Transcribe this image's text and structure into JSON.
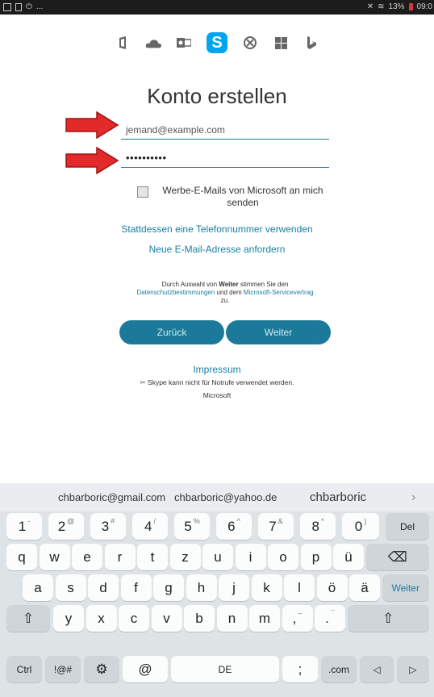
{
  "status_bar": {
    "left_dots": "...",
    "battery": "13%",
    "time": "09:0"
  },
  "app_icons": [
    "office-icon",
    "onedrive-icon",
    "outlook-icon",
    "skype-icon",
    "xbox-icon",
    "windows-icon",
    "bing-icon"
  ],
  "skype_letter": "S",
  "form": {
    "title": "Konto erstellen",
    "email_value": "jemand@example.com",
    "password_value": "••••••••••",
    "checkbox_label": "Werbe-E-Mails von Microsoft an mich senden",
    "phone_link": "Stattdessen eine Telefonnummer verwenden",
    "new_email_link": "Neue E-Mail-Adresse anfordern",
    "legal": {
      "text1": "Durch Auswahl von ",
      "bold": "Weiter",
      "text2": " stimmen Sie den",
      "link1": "Datenschutzbestimmungen",
      "text3": " und dem ",
      "link2": "Microsoft-Servicevertrag",
      "text4": "zu."
    },
    "back_button": "Zurück",
    "next_button": "Weiter",
    "impressum": "Impressum",
    "notruf": "Skype kann nicht für Notrufe verwendet werden.",
    "microsoft": "Microsoft"
  },
  "keyboard": {
    "suggestions": [
      "chbarboric@gmail.com",
      "chbarboric@yahoo.de",
      "chbarboric"
    ],
    "suggest_more": "›",
    "num_row": [
      [
        "1",
        "-"
      ],
      [
        "2",
        "@"
      ],
      [
        "3",
        "#"
      ],
      [
        "4",
        "/"
      ],
      [
        "5",
        "%"
      ],
      [
        "6",
        "^"
      ],
      [
        "7",
        "&"
      ],
      [
        "8",
        "*"
      ],
      [
        "9",
        "("
      ],
      [
        "0",
        ")"
      ]
    ],
    "del": "Del",
    "row_q": [
      "q",
      "w",
      "e",
      "r",
      "t",
      "z",
      "u",
      "i",
      "o",
      "p",
      "ü"
    ],
    "backspace": "⌫",
    "row_a": [
      "a",
      "s",
      "d",
      "f",
      "g",
      "h",
      "j",
      "k",
      "l",
      "ö",
      "ä"
    ],
    "enter": "Weiter",
    "shift": "⇧",
    "row_y": [
      "y",
      "x",
      "c",
      "v",
      "b",
      "n",
      "m"
    ],
    "comma": ",",
    "comma_sup": "–",
    "period": ".",
    "period_sup": "¯",
    "ctrl": "Ctrl",
    "symbols": "!@#",
    "settings": "⚙",
    "at": "@",
    "space": "DE",
    "semicolon": ";",
    "dotcom": ".com",
    "left": "◁",
    "right": "▷"
  }
}
